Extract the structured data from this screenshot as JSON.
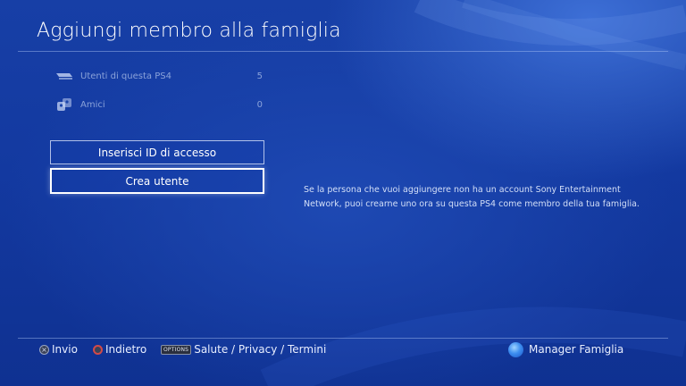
{
  "header": {
    "title": "Aggiungi membro alla famiglia"
  },
  "sources": [
    {
      "label": "Utenti di questa PS4",
      "count": "5",
      "icon": "ps4-console-icon"
    },
    {
      "label": "Amici",
      "count": "0",
      "icon": "friends-icon"
    }
  ],
  "buttons": {
    "enter_id": "Inserisci ID di accesso",
    "create_user": "Crea utente"
  },
  "info_text": "Se la persona che vuoi aggiungere non ha un account Sony Entertainment Network, puoi crearne uno ora su questa PS4 come membro della tua famiglia.",
  "footer": {
    "confirm": "Invio",
    "back": "Indietro",
    "options_badge": "OPTIONS",
    "options_label": "Salute / Privacy / Termini",
    "family_manager": "Manager Famiglia"
  },
  "colors": {
    "background": "#1339a0",
    "text": "#ffffff"
  }
}
